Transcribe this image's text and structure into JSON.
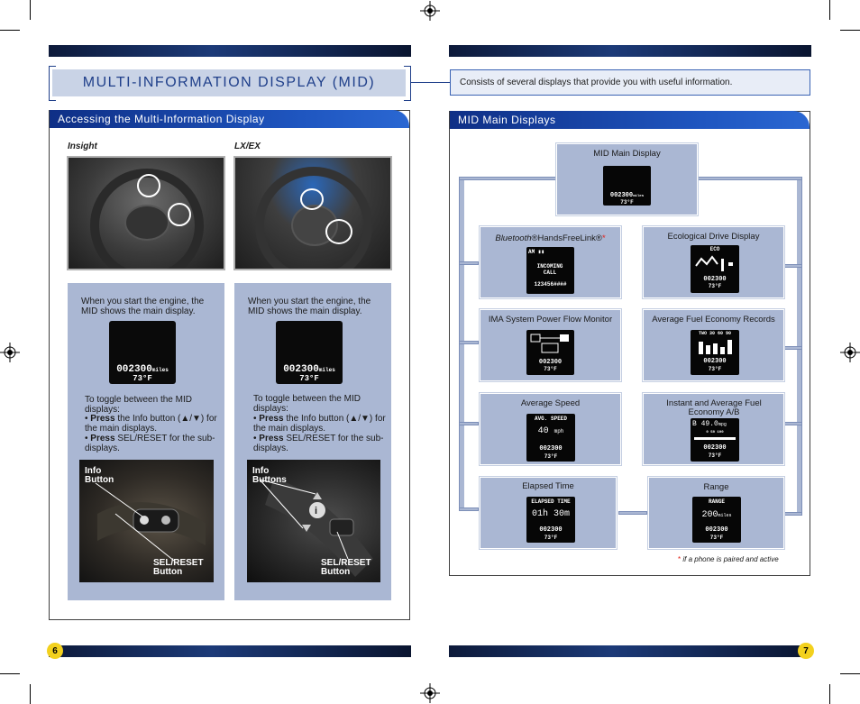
{
  "title": "MULTI-INFORMATION DISPLAY (MID)",
  "intro": "Consists of several displays that provide you with useful information.",
  "left_section": {
    "header": "Accessing the Multi-Information Display",
    "columns": [
      {
        "model": "Insight",
        "start_text": "When you start the engine, the MID shows the main display.",
        "screen_odometer": "002300",
        "screen_unit": "miles",
        "screen_temp": "73°F",
        "toggle_intro": "To toggle between the MID displays:",
        "bullet1_bold": "Press",
        "bullet1_rest": "the Info button (▲/▼) for the main displays.",
        "bullet2_bold": "Press",
        "bullet2_rest": "SEL/RESET for the sub-displays.",
        "info_label_1": "Info",
        "info_label_2": "Button",
        "sel_label_1": "SEL/RESET",
        "sel_label_2": "Button"
      },
      {
        "model": "LX/EX",
        "start_text": "When you start the engine, the MID shows the main display.",
        "screen_odometer": "002300",
        "screen_unit": "miles",
        "screen_temp": "73°F",
        "toggle_intro": "To toggle between the MID displays:",
        "bullet1_bold": "Press",
        "bullet1_rest": "the Info button (▲/▼) for the main displays.",
        "bullet2_bold": "Press",
        "bullet2_rest": "SEL/RESET for the sub-displays.",
        "info_label_1": "Info",
        "info_label_2": "Buttons",
        "sel_label_1": "SEL/RESET",
        "sel_label_2": "Button"
      }
    ]
  },
  "right_section": {
    "header": "MID Main Displays",
    "main_display": {
      "label": "MID Main Display",
      "odometer": "002300",
      "unit": "miles",
      "temp": "73°F"
    },
    "displays": [
      {
        "label_italic": "Bluetooth",
        "label_rest": "®HandsFreeLink®",
        "star": "*",
        "screen_title": "INCOMING CALL",
        "screen_value": "123456####"
      },
      {
        "label": "Ecological Drive Display",
        "screen_title": "ECO",
        "odometer": "002300",
        "temp": "73°F"
      },
      {
        "label": "IMA System Power Flow Monitor",
        "odometer": "002300",
        "temp": "73°F"
      },
      {
        "label": "Average Fuel Economy Records",
        "screen_title": "TWO 30 60 90",
        "odometer": "002300",
        "temp": "73°F"
      },
      {
        "label": "Average Speed",
        "screen_title": "AVG. SPEED",
        "screen_value": "40",
        "screen_unit": "mph",
        "odometer": "002300",
        "temp": "73°F"
      },
      {
        "label": "Instant and Average Fuel Economy A/B",
        "screen_value": "B  49.0",
        "screen_unit": "mpg",
        "scale": "0   50   100",
        "odometer": "002300",
        "temp": "73°F"
      },
      {
        "label": "Elapsed Time",
        "screen_title": "ELAPSED TIME",
        "screen_value": "01h 30m",
        "odometer": "002300",
        "temp": "73°F"
      },
      {
        "label": "Range",
        "screen_title": "RANGE",
        "screen_value": "200",
        "screen_unit": "miles",
        "odometer": "002300",
        "temp": "73°F"
      }
    ],
    "footnote_star": "*",
    "footnote": "if a phone is paired and active"
  },
  "page_numbers": {
    "left": "6",
    "right": "7"
  },
  "colors": {
    "navy": "#0d1a3a",
    "header_blue": "#1f56c0",
    "panel": "#aab7d3",
    "title_blue": "#1f3f8a",
    "page_yellow": "#f3d11d",
    "star_red": "#e2231a"
  }
}
